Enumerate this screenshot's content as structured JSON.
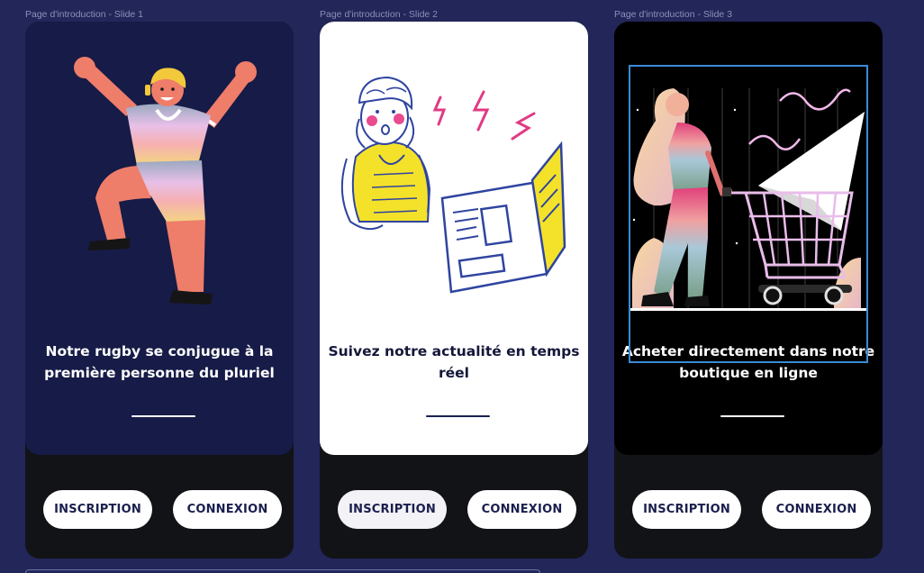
{
  "colors": {
    "canvas_bg": "#222659",
    "slide1_panel": "#161b47",
    "slide2_panel": "#ffffff",
    "slide3_panel": "#000000",
    "button_text": "#1a1f4d",
    "selection": "#3a8ad8"
  },
  "slides": [
    {
      "frame_label": "Page d'introduction - Slide 1",
      "caption": "Notre rugby se conjugue à la première personne du pluriel",
      "illustration_icon": "rugby-player-icon",
      "signup_label": "INSCRIPTION",
      "login_label": "CONNEXION"
    },
    {
      "frame_label": "Page d'introduction - Slide 2",
      "caption": "Suivez notre actualité en temps réel",
      "illustration_icon": "newspaper-reader-icon",
      "signup_label": "INSCRIPTION",
      "login_label": "CONNEXION"
    },
    {
      "frame_label": "Page d'introduction - Slide 3",
      "caption": "Acheter directement dans notre boutique en ligne",
      "illustration_icon": "shopping-cart-icon",
      "signup_label": "INSCRIPTION",
      "login_label": "CONNEXION"
    }
  ]
}
